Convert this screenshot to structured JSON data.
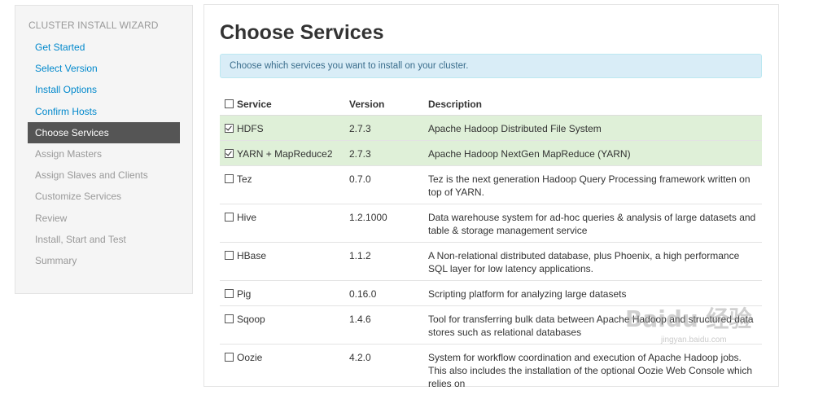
{
  "sidebar": {
    "title": "CLUSTER INSTALL WIZARD",
    "items": [
      {
        "label": "Get Started",
        "state": "done"
      },
      {
        "label": "Select Version",
        "state": "done"
      },
      {
        "label": "Install Options",
        "state": "done"
      },
      {
        "label": "Confirm Hosts",
        "state": "done"
      },
      {
        "label": "Choose Services",
        "state": "active"
      },
      {
        "label": "Assign Masters",
        "state": "todo"
      },
      {
        "label": "Assign Slaves and Clients",
        "state": "todo"
      },
      {
        "label": "Customize Services",
        "state": "todo"
      },
      {
        "label": "Review",
        "state": "todo"
      },
      {
        "label": "Install, Start and Test",
        "state": "todo"
      },
      {
        "label": "Summary",
        "state": "todo"
      }
    ]
  },
  "main": {
    "title": "Choose Services",
    "info": "Choose which services you want to install on your cluster.",
    "columns": {
      "service": "Service",
      "version": "Version",
      "description": "Description"
    },
    "services": [
      {
        "name": "HDFS",
        "version": "2.7.3",
        "description": "Apache Hadoop Distributed File System",
        "checked": true
      },
      {
        "name": "YARN + MapReduce2",
        "version": "2.7.3",
        "description": "Apache Hadoop NextGen MapReduce (YARN)",
        "checked": true
      },
      {
        "name": "Tez",
        "version": "0.7.0",
        "description": "Tez is the next generation Hadoop Query Processing framework written on top of YARN.",
        "checked": false
      },
      {
        "name": "Hive",
        "version": "1.2.1000",
        "description": "Data warehouse system for ad-hoc queries & analysis of large datasets and table & storage management service",
        "checked": false
      },
      {
        "name": "HBase",
        "version": "1.1.2",
        "description": "A Non-relational distributed database, plus Phoenix, a high performance SQL layer for low latency applications.",
        "checked": false
      },
      {
        "name": "Pig",
        "version": "0.16.0",
        "description": "Scripting platform for analyzing large datasets",
        "checked": false
      },
      {
        "name": "Sqoop",
        "version": "1.4.6",
        "description": "Tool for transferring bulk data between Apache Hadoop and structured data stores such as relational databases",
        "checked": false
      },
      {
        "name": "Oozie",
        "version": "4.2.0",
        "description": "System for workflow coordination and execution of Apache Hadoop jobs. This also includes the installation of the optional Oozie Web Console which relies on",
        "checked": false
      }
    ]
  },
  "watermark": {
    "text": "Baidu 经验",
    "sub": "jingyan.baidu.com"
  },
  "colors": {
    "active_nav": "#555555",
    "link": "#0088cc",
    "selected_row": "#dff0d8",
    "info_bg": "#d9edf7"
  }
}
